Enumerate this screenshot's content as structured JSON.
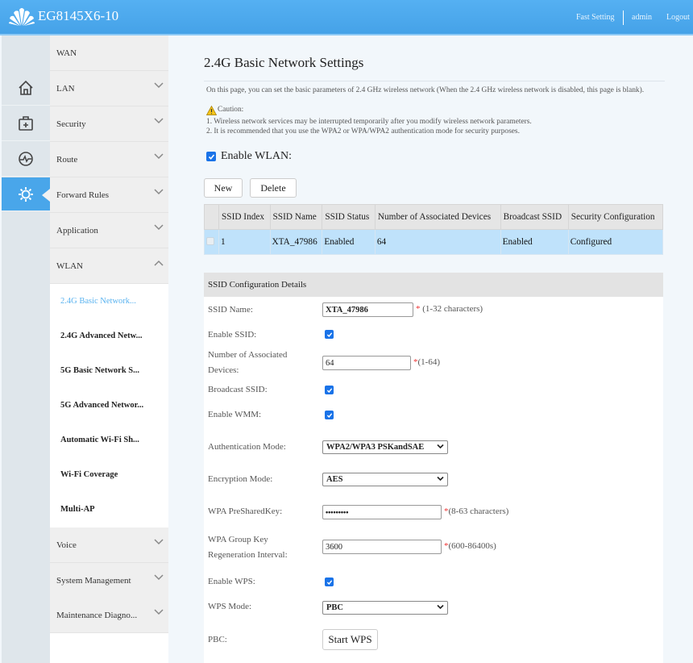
{
  "header": {
    "title": "EG8145X6-10",
    "links": [
      "Fast Setting",
      "admin",
      "Logout"
    ]
  },
  "icons": [
    "home-icon",
    "toolbox-icon",
    "monitor-icon",
    "gear-icon"
  ],
  "menu": {
    "items": [
      "WAN",
      "LAN",
      "Security",
      "Route",
      "Forward Rules",
      "Application",
      "WLAN"
    ],
    "subitems": [
      "2.4G Basic Network...",
      "2.4G Advanced Netw...",
      "5G Basic Network S...",
      "5G Advanced Networ...",
      "Automatic Wi-Fi Sh...",
      "Wi-Fi Coverage",
      "Multi-AP"
    ],
    "items_after": [
      "Voice",
      "System Management",
      "Maintenance Diagno..."
    ]
  },
  "page": {
    "title": "2.4G Basic Network Settings",
    "intro": "On this page, you can set the basic parameters of 2.4 GHz wireless network (When the 2.4 GHz wireless network is disabled, this page is blank).",
    "caution": "Caution:",
    "notes": [
      "1. Wireless network services may be interrupted temporarily after you modify wireless network parameters.",
      "2. It is recommended that you use the WPA2 or WPA/WPA2 authentication mode for security purposes."
    ],
    "enable_wlan": "Enable WLAN:",
    "new": "New",
    "delete": "Delete"
  },
  "table": {
    "headers": [
      "SSID Index",
      "SSID Name",
      "SSID Status",
      "Number of Associated Devices",
      "Broadcast SSID",
      "Security Configuration"
    ],
    "rows": [
      [
        "1",
        "XTA_47986",
        "Enabled",
        "64",
        "Enabled",
        "Configured"
      ]
    ]
  },
  "form": {
    "section_title": "SSID Configuration Details",
    "ssid_name": {
      "label": "SSID Name:",
      "value": "XTA_47986",
      "hint": "(1-32 characters)"
    },
    "enable_ssid": {
      "label": "Enable SSID:",
      "checked": true
    },
    "assoc": {
      "label1": "Number of Associated",
      "label2": "Devices:",
      "value": "64",
      "hint": "(1-64)"
    },
    "broadcast": {
      "label": "Broadcast SSID:",
      "checked": true
    },
    "wmm": {
      "label": "Enable WMM:",
      "checked": true
    },
    "auth": {
      "label": "Authentication Mode:",
      "value": "WPA2/WPA3 PSKandSAE"
    },
    "enc": {
      "label": "Encryption Mode:",
      "value": "AES"
    },
    "psk": {
      "label": "WPA PreSharedKey:",
      "hint": "(8-63 characters)"
    },
    "rekey": {
      "label1": "WPA Group Key",
      "label2": "Regeneration Interval:",
      "value": "3600",
      "hint": "(600-86400s)"
    },
    "wps": {
      "label": "Enable WPS:",
      "checked": true
    },
    "wps_mode": {
      "label": "WPS Mode:",
      "value": "PBC"
    },
    "pbc": {
      "label": "PBC:",
      "button": "Start WPS"
    }
  },
  "colors": {
    "accent": "#49a6ea",
    "row_selected": "#bfe2fb",
    "required": "#e33333"
  }
}
